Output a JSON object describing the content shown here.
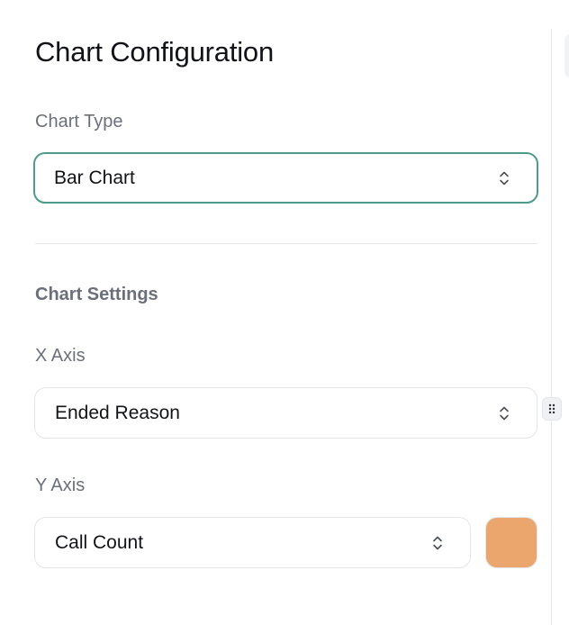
{
  "panel": {
    "title": "Chart Configuration"
  },
  "chart_type": {
    "label": "Chart Type",
    "value": "Bar Chart",
    "icon": "chevron-up-down-icon"
  },
  "chart_settings": {
    "title": "Chart Settings",
    "x_axis": {
      "label": "X Axis",
      "value": "Ended Reason",
      "icon": "chevron-up-down-icon"
    },
    "y_axis": {
      "label": "Y Axis",
      "value": "Call Count",
      "icon": "chevron-up-down-icon",
      "color": "#EAA66C"
    }
  },
  "handles": {
    "drag_icon": "drag-handle-icon"
  },
  "colors": {
    "focus_border": "#4E9A8C",
    "label_text": "#6B6F7B",
    "series_color": "#EAA66C"
  }
}
